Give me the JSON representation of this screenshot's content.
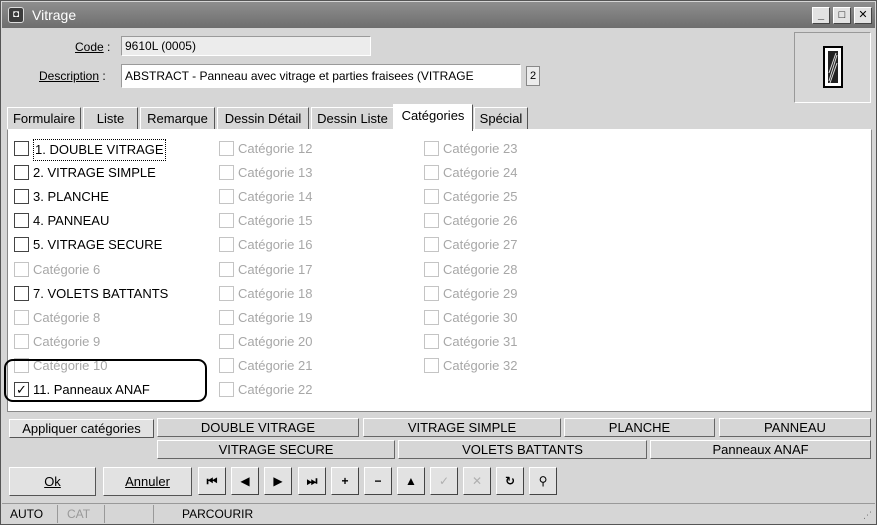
{
  "window": {
    "title": "Vitrage",
    "minimize_label": "_",
    "maximize_label": "□",
    "close_label": "✕"
  },
  "form": {
    "code_label": "Code",
    "code_value": "9610L (0005)",
    "description_label": "Description",
    "description_value": "ABSTRACT - Panneau avec vitrage et parties fraisees (VITRAGE",
    "description_extra": "2"
  },
  "tabs": [
    {
      "label": "Formulaire"
    },
    {
      "label": "Liste"
    },
    {
      "label": "Remarque"
    },
    {
      "label": "Dessin Détail"
    },
    {
      "label": "Dessin Liste"
    },
    {
      "label": "Catégories"
    },
    {
      "label": "Spécial"
    }
  ],
  "categories": [
    {
      "label": "1. DOUBLE VITRAGE",
      "checked": false,
      "enabled": true
    },
    {
      "label": "2. VITRAGE SIMPLE",
      "checked": false,
      "enabled": true
    },
    {
      "label": "3. PLANCHE",
      "checked": false,
      "enabled": true
    },
    {
      "label": "4. PANNEAU",
      "checked": false,
      "enabled": true
    },
    {
      "label": "5. VITRAGE SECURE",
      "checked": false,
      "enabled": true
    },
    {
      "label": "Catégorie 6",
      "checked": false,
      "enabled": false
    },
    {
      "label": "7. VOLETS BATTANTS",
      "checked": false,
      "enabled": true
    },
    {
      "label": "Catégorie 8",
      "checked": false,
      "enabled": false
    },
    {
      "label": "Catégorie 9",
      "checked": false,
      "enabled": false
    },
    {
      "label": "Catégorie 10",
      "checked": false,
      "enabled": false
    },
    {
      "label": "11. Panneaux ANAF",
      "checked": true,
      "enabled": true
    },
    {
      "label": "Catégorie 12",
      "checked": false,
      "enabled": false
    },
    {
      "label": "Catégorie 13",
      "checked": false,
      "enabled": false
    },
    {
      "label": "Catégorie 14",
      "checked": false,
      "enabled": false
    },
    {
      "label": "Catégorie 15",
      "checked": false,
      "enabled": false
    },
    {
      "label": "Catégorie 16",
      "checked": false,
      "enabled": false
    },
    {
      "label": "Catégorie 17",
      "checked": false,
      "enabled": false
    },
    {
      "label": "Catégorie 18",
      "checked": false,
      "enabled": false
    },
    {
      "label": "Catégorie 19",
      "checked": false,
      "enabled": false
    },
    {
      "label": "Catégorie 20",
      "checked": false,
      "enabled": false
    },
    {
      "label": "Catégorie 21",
      "checked": false,
      "enabled": false
    },
    {
      "label": "Catégorie 22",
      "checked": false,
      "enabled": false
    },
    {
      "label": "Catégorie 23",
      "checked": false,
      "enabled": false
    },
    {
      "label": "Catégorie 24",
      "checked": false,
      "enabled": false
    },
    {
      "label": "Catégorie 25",
      "checked": false,
      "enabled": false
    },
    {
      "label": "Catégorie 26",
      "checked": false,
      "enabled": false
    },
    {
      "label": "Catégorie 27",
      "checked": false,
      "enabled": false
    },
    {
      "label": "Catégorie 28",
      "checked": false,
      "enabled": false
    },
    {
      "label": "Catégorie 29",
      "checked": false,
      "enabled": false
    },
    {
      "label": "Catégorie 30",
      "checked": false,
      "enabled": false
    },
    {
      "label": "Catégorie 31",
      "checked": false,
      "enabled": false
    },
    {
      "label": "Catégorie 32",
      "checked": false,
      "enabled": false
    }
  ],
  "category_bar": {
    "apply_label": "Appliquer catégories",
    "row1": [
      "DOUBLE VITRAGE",
      "VITRAGE SIMPLE",
      "PLANCHE",
      "PANNEAU"
    ],
    "row2": [
      "VITRAGE SECURE",
      "VOLETS BATTANTS",
      "Panneaux ANAF"
    ]
  },
  "actions": {
    "ok_label": "Ok",
    "cancel_label": "Annuler"
  },
  "nav_buttons": [
    {
      "name": "first-record-button",
      "icon": "first-icon",
      "glyph": "⏮",
      "enabled": true
    },
    {
      "name": "previous-record-button",
      "icon": "previous-icon",
      "glyph": "◀",
      "enabled": true
    },
    {
      "name": "next-record-button",
      "icon": "next-icon",
      "glyph": "▶",
      "enabled": true
    },
    {
      "name": "last-record-button",
      "icon": "last-icon",
      "glyph": "⏭",
      "enabled": true
    },
    {
      "name": "add-record-button",
      "icon": "plus-icon",
      "glyph": "+",
      "enabled": true
    },
    {
      "name": "delete-record-button",
      "icon": "minus-icon",
      "glyph": "−",
      "enabled": true
    },
    {
      "name": "up-button",
      "icon": "up-arrow-icon",
      "glyph": "▲",
      "enabled": true
    },
    {
      "name": "confirm-button",
      "icon": "check-icon",
      "glyph": "✓",
      "enabled": false
    },
    {
      "name": "cancel-edit-button",
      "icon": "x-icon",
      "glyph": "✕",
      "enabled": false
    },
    {
      "name": "refresh-button",
      "icon": "refresh-icon",
      "glyph": "↻",
      "enabled": true
    },
    {
      "name": "search-button",
      "icon": "binoculars-icon",
      "glyph": "⚲",
      "enabled": true
    }
  ],
  "status": {
    "mode": "AUTO",
    "cat": "CAT",
    "state": "PARCOURIR"
  }
}
